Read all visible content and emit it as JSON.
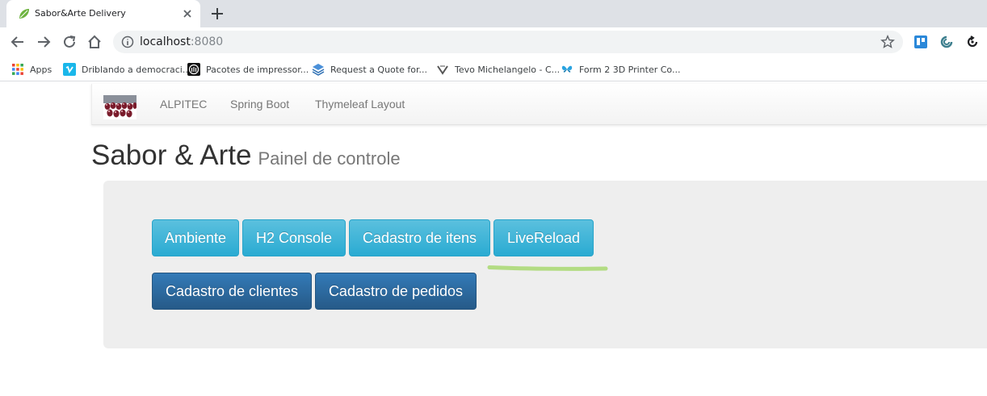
{
  "browser": {
    "tab_title": "Sabor&Arte Delivery",
    "url_host": "localhost",
    "url_port": ":8080",
    "bookmarks": [
      {
        "label": "Apps",
        "icon": "apps-grid-icon"
      },
      {
        "label": "Driblando a democraci...",
        "icon": "vimeo-icon"
      },
      {
        "label": "Pacotes de impressor...",
        "icon": "makerbot-icon"
      },
      {
        "label": "Request a Quote for...",
        "icon": "stack-icon"
      },
      {
        "label": "Tevo Michelangelo - C...",
        "icon": "tevo-icon"
      },
      {
        "label": "Form 2 3D Printer Co...",
        "icon": "butterfly-icon"
      }
    ]
  },
  "navbar": {
    "links": [
      "ALPITEC",
      "Spring Boot",
      "Thymeleaf Layout"
    ]
  },
  "header": {
    "title": "Sabor & Arte",
    "subtitle": "Painel de controle"
  },
  "buttons": {
    "row1": [
      "Ambiente",
      "H2 Console",
      "Cadastro de itens",
      "LiveReload"
    ],
    "row2": [
      "Cadastro de clientes",
      "Cadastro de pedidos"
    ]
  },
  "colors": {
    "info": "#31b0d5",
    "primary": "#286090",
    "highlight": "#a8d870"
  }
}
